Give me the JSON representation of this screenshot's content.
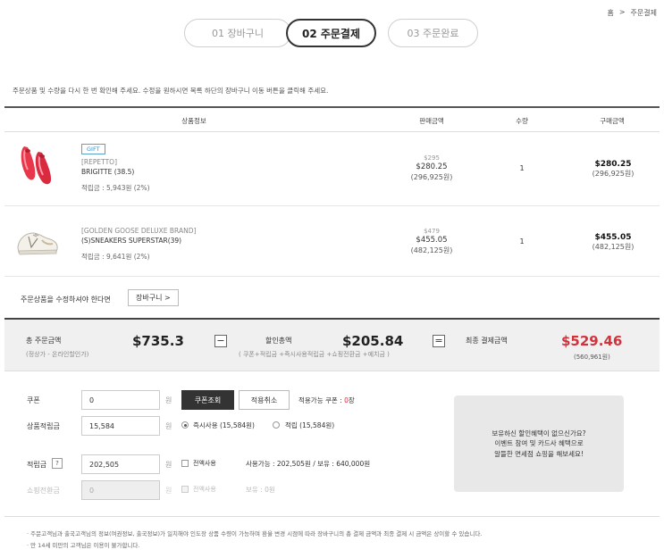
{
  "breadcrumb": {
    "home": "홈",
    "sep": ">",
    "current": "주문결제"
  },
  "steps": [
    {
      "label": "01 장바구니"
    },
    {
      "label": "02 주문결제"
    },
    {
      "label": "03 주문완료"
    }
  ],
  "notice": "주문상품 및 수량을 다시 한 번 확인해 주세요. 수정을 원하시면 목록 하단의 장바구니 이동 버튼을 클릭해 주세요.",
  "table": {
    "headers": {
      "product": "상품정보",
      "sale_price": "판매금액",
      "qty": "수량",
      "purchase": "구매금액"
    },
    "rows": [
      {
        "badge": "GIFT",
        "brand": "[REPETTO]",
        "name": "BRIGITTE (38.5)",
        "points": "적립금 : 5,943원 (2%)",
        "orig_price": "$295",
        "price": "$280.25",
        "price_krw": "(296,925원)",
        "qty": "1",
        "total": "$280.25",
        "total_krw": "(296,925원)"
      },
      {
        "brand": "[GOLDEN GOOSE DELUXE BRAND]",
        "name": "(S)SNEAKERS SUPERSTAR(39)",
        "points": "적립금 : 9,641원 (2%)",
        "orig_price": "$479",
        "price": "$455.05",
        "price_krw": "(482,125원)",
        "qty": "1",
        "total": "$455.05",
        "total_krw": "(482,125원)"
      }
    ]
  },
  "modify": {
    "text": "주문상품을 수정하셔야 한다면",
    "button": "장바구니 >"
  },
  "summary": {
    "total_label": "총 주문금액",
    "total_sub": "(정상가 - 온라인할인가)",
    "total_value": "$735.3",
    "minus": "−",
    "discount_label": "할인총액",
    "discount_sub": "( 쿠폰+적립금 +즉시사용적립금 +쇼핑전환금 +예치금 )",
    "discount_value": "$205.84",
    "equals": "=",
    "final_label": "최종 결제금액",
    "final_value": "$529.46",
    "final_krw": "(560,961원)"
  },
  "form": {
    "coupon": {
      "label": "쿠폰",
      "value": "0",
      "unit": "원",
      "btn_search": "쿠폰조회",
      "btn_cancel": "적용취소",
      "available_prefix": "적용가능 쿠폰 : ",
      "available_count": "0",
      "available_suffix": "장"
    },
    "product_points": {
      "label": "상품적립금",
      "value": "15,584",
      "unit": "원",
      "opt_instant": "즉시사용 (15,584원)",
      "opt_accum": "적립 (15,584원)"
    },
    "points": {
      "label": "적립금",
      "help": "?",
      "value": "202,505",
      "unit": "원",
      "opt_all": "전액사용",
      "info": "사용가능 : 202,505원 / 보유 : 640,000원"
    },
    "shopping": {
      "label": "쇼핑전환금",
      "value": "0",
      "unit": "원",
      "opt_all": "전액사용",
      "info": "보유 : 0원"
    }
  },
  "promo": {
    "line1": "보유하신 할인혜택이 없으신가요?",
    "line2": "이벤트 참여 및 카드사 혜택으로",
    "line3": "알뜰한 면세점 쇼핑을 해보세요!"
  },
  "footnotes": [
    "· 주문고객님과 출국고객님의 정보(여권정보, 출국정보)가 일치해야 인도장 상품 수령이 가능하며 환율 변경 시점에 따라 장바구니의 총 결제 금액과 최종 결제 시 금액은 상이할 수 있습니다.",
    "· 만 14세 미만의 고객님은 이용이 불가합니다."
  ],
  "colors": {
    "accent_red": "#d5313c",
    "gift_blue": "#3a8fc0"
  }
}
